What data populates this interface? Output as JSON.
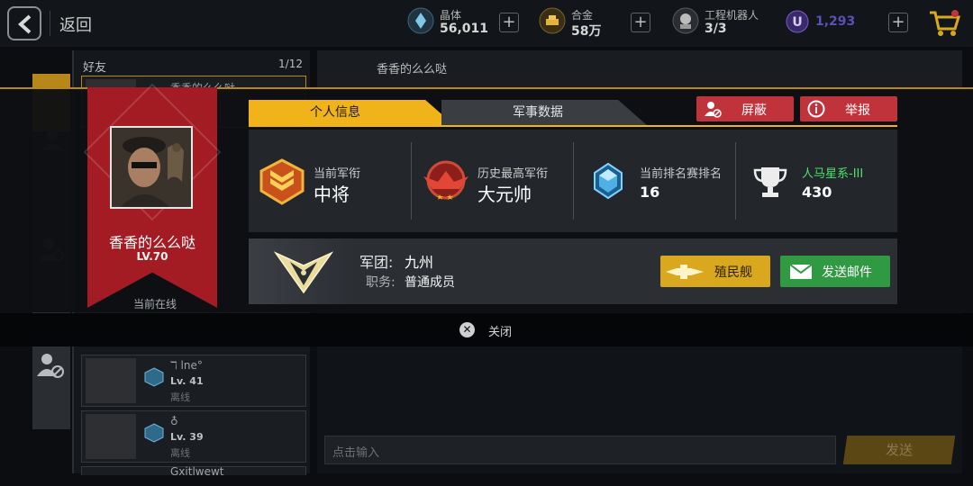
{
  "topbar": {
    "back_label": "返回",
    "resources": [
      {
        "name": "晶体",
        "value": "56,011"
      },
      {
        "name": "合金",
        "value": "58万"
      },
      {
        "name": "工程机器人",
        "value": "3/3"
      },
      {
        "name": "",
        "value": "1,293"
      }
    ],
    "plus_symbol": "+"
  },
  "friends": {
    "title": "好友",
    "count": "1/12",
    "rows": [
      {
        "name": "香香的么么哒",
        "level": "",
        "status": ""
      },
      {
        "name": "ℸ lne°",
        "level": "Lv. 41",
        "status": "离线"
      },
      {
        "name": "♁",
        "level": "Lv. 39",
        "status": "离线"
      },
      {
        "name": "Gxitlwewt",
        "level": "",
        "status": ""
      }
    ]
  },
  "chat": {
    "header_name": "香香的么么哒",
    "input_placeholder": "点击输入",
    "send_label": "发送"
  },
  "modal": {
    "player": {
      "name": "香香的么么哒",
      "level": "LV.70",
      "status": "当前在线"
    },
    "tabs": [
      "个人信息",
      "军事数据"
    ],
    "active_tab": 0,
    "block_label": "屏蔽",
    "report_label": "举报",
    "stats": [
      {
        "label": "当前军衔",
        "value": "中将"
      },
      {
        "label": "历史最高军衔",
        "value": "大元帅"
      },
      {
        "label": "当前排名赛排名",
        "value": "16"
      },
      {
        "label": "人马星系-III",
        "value": "430"
      }
    ],
    "legion": {
      "name_label": "军团:",
      "name": "九州",
      "role_label": "职务:",
      "role": "普通成员"
    },
    "colony_label": "殖民舰",
    "mail_label": "发送邮件",
    "close_label": "关闭"
  },
  "colors": {
    "accent_gold": "#f0b31a",
    "banner_red": "#a41c23",
    "danger_red": "#c0333b",
    "mail_green": "#2f9a42",
    "galaxy_green": "#4fe06a"
  },
  "icons": {
    "back": "chevron-left-icon",
    "crystal": "crystal-icon",
    "alloy": "alloy-icon",
    "robot": "robot-icon",
    "premium": "u-currency-icon",
    "cart": "cart-icon",
    "block": "block-user-icon",
    "report": "info-icon",
    "rank_current": "rank-badge-icon",
    "rank_highest": "eagle-rank-badge-icon",
    "ladder_rank": "crystal-rank-icon",
    "galaxy": "trophy-icon",
    "legion_emblem": "legion-emblem-icon",
    "colony_ship": "colony-ship-icon",
    "mail": "envelope-icon",
    "close": "close-circle-icon"
  }
}
